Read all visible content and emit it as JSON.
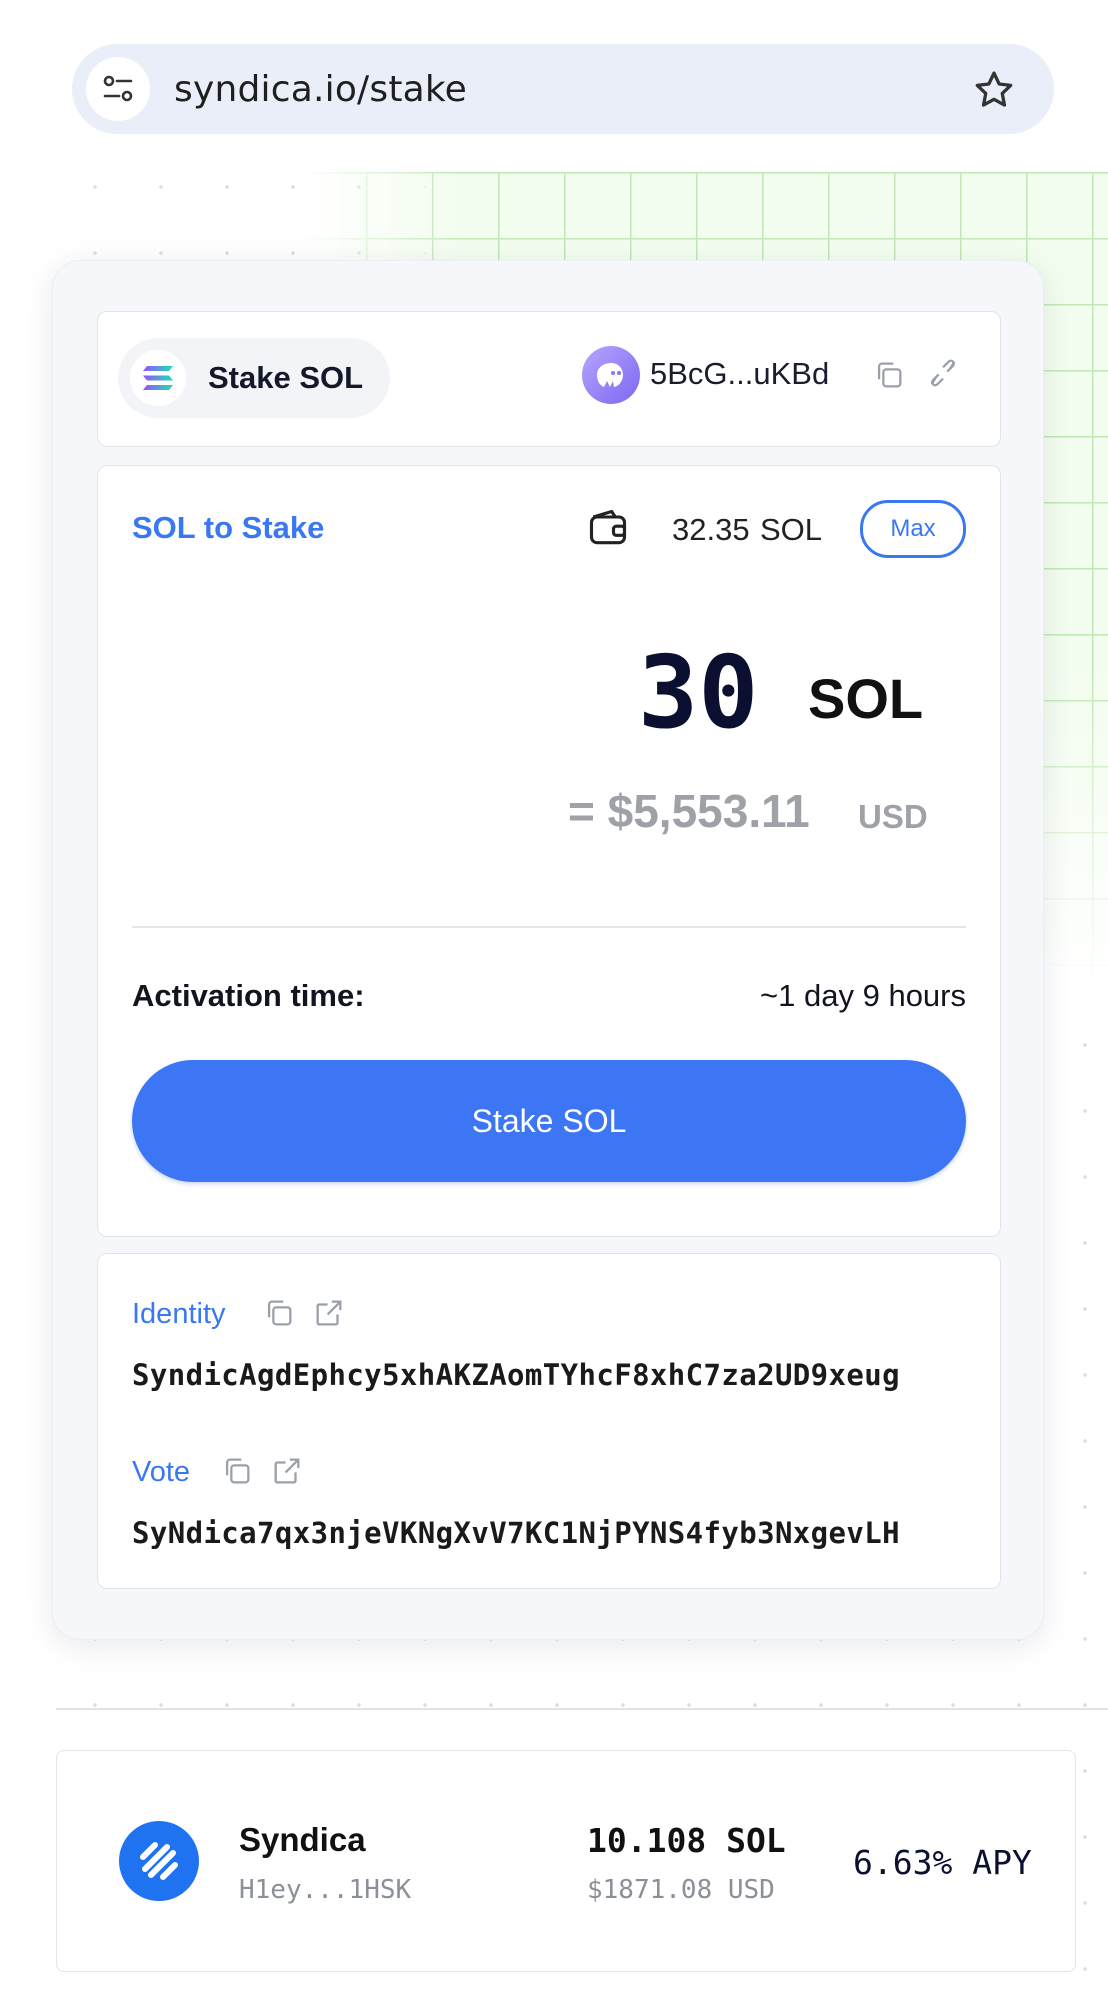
{
  "browser": {
    "url": "syndica.io/stake",
    "tune_icon": "tune-icon",
    "star_icon": "star-icon"
  },
  "header": {
    "title": "Stake SOL",
    "logo_icon": "solana-logo-icon",
    "wallet_address": "5BcG...uKBd",
    "copy_icon": "copy-icon",
    "disconnect_icon": "disconnect-icon"
  },
  "stake_form": {
    "label": "SOL to Stake",
    "wallet_icon": "wallet-icon",
    "balance_amount": "32.35",
    "balance_unit": "SOL",
    "max_label": "Max",
    "amount": "30",
    "amount_unit": "SOL",
    "usd_value": "= $5,553.11",
    "usd_unit": "USD",
    "activation_label": "Activation time:",
    "activation_value": "~1 day 9 hours",
    "stake_button_label": "Stake SOL"
  },
  "validator_info": {
    "identity_label": "Identity",
    "identity_address": "SyndicAgdEphcy5xhAKZAomTYhcF8xhC7za2UD9xeug",
    "vote_label": "Vote",
    "vote_address": "SyNdica7qx3njeVKNgXvV7KC1NjPYNS4fyb3NxgevLH"
  },
  "validator_card": {
    "name": "Syndica",
    "short_address": "H1ey...1HSK",
    "stake": "10.108 SOL",
    "usd": "$1871.08 USD",
    "apy": "6.63% APY"
  },
  "colors": {
    "accent": "#3c76f4",
    "grid": "#bfe8b4",
    "muted": "#9ea1a8"
  }
}
